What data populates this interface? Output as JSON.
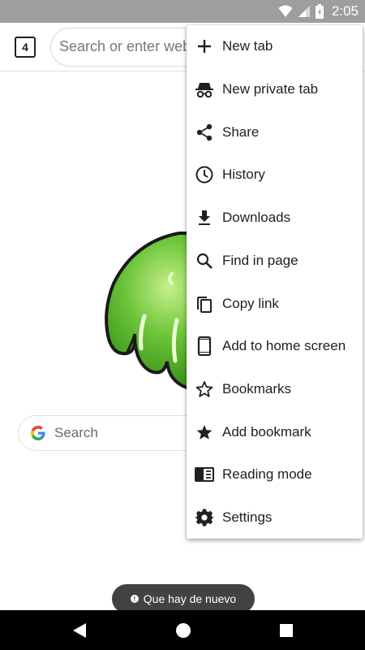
{
  "status_bar": {
    "time": "2:05"
  },
  "toolbar": {
    "tab_count": "4",
    "omnibox_placeholder": "Search or enter web address"
  },
  "page": {
    "search_placeholder": "Search",
    "whats_new_label": "Que hay de nuevo"
  },
  "menu": {
    "items": [
      {
        "label": "New tab",
        "icon": "plus-icon"
      },
      {
        "label": "New private tab",
        "icon": "incognito-icon"
      },
      {
        "label": "Share",
        "icon": "share-icon"
      },
      {
        "label": "History",
        "icon": "clock-icon"
      },
      {
        "label": "Downloads",
        "icon": "download-icon"
      },
      {
        "label": "Find in page",
        "icon": "search-icon"
      },
      {
        "label": "Copy link",
        "icon": "copy-icon"
      },
      {
        "label": "Add to home screen",
        "icon": "phone-icon"
      },
      {
        "label": "Bookmarks",
        "icon": "star-outline-icon"
      },
      {
        "label": "Add bookmark",
        "icon": "star-filled-icon"
      },
      {
        "label": "Reading mode",
        "icon": "reading-mode-icon"
      },
      {
        "label": "Settings",
        "icon": "gear-icon"
      }
    ]
  },
  "colors": {
    "status_bar": "#9e9e9e",
    "nav_bar": "#000000",
    "logo_green": "#5cb82e",
    "toast_bg": "#424242"
  }
}
